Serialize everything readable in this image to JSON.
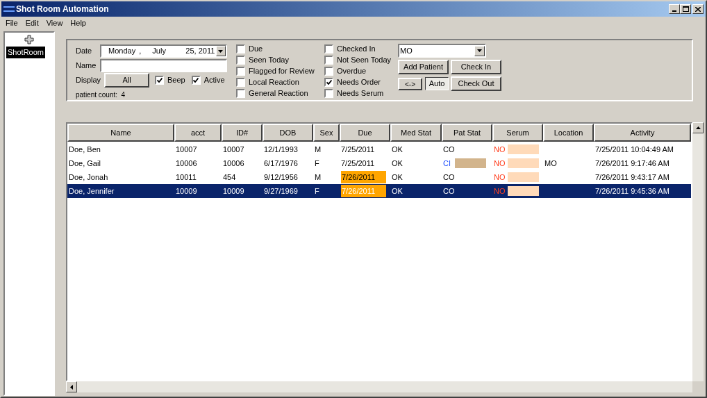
{
  "window": {
    "title": "Shot Room Automation"
  },
  "menu": [
    "File",
    "Edit",
    "View",
    "Help"
  ],
  "tree": {
    "items": [
      {
        "label": "ShotRoom",
        "selected": true
      }
    ]
  },
  "filters": {
    "date_label": "Date",
    "date": {
      "weekday": "Monday",
      "sep": ",",
      "month": "July",
      "day_year": "25, 2011"
    },
    "name_label": "Name",
    "display_label": "Display",
    "display_button": "All",
    "beep": {
      "label": "Beep",
      "checked": true
    },
    "active": {
      "label": "Active",
      "checked": true
    },
    "patient_count": "patient count:  4",
    "checkboxes": [
      [
        {
          "label": "Due",
          "checked": false
        },
        {
          "label": "Seen Today",
          "checked": false
        },
        {
          "label": "Flagged for Review",
          "checked": false
        },
        {
          "label": "Local Reaction",
          "checked": false
        },
        {
          "label": "General Reaction",
          "checked": false
        }
      ],
      [
        {
          "label": "Checked In",
          "checked": false
        },
        {
          "label": "Not Seen Today",
          "checked": false
        },
        {
          "label": "Overdue",
          "checked": false
        },
        {
          "label": "Needs Order",
          "checked": true
        },
        {
          "label": "Needs Serum",
          "checked": false
        }
      ]
    ],
    "location": "MO",
    "add_patient": "Add Patient",
    "check_in": "Check In",
    "swap": "<->",
    "auto": {
      "label": "Auto",
      "on": true
    },
    "check_out": "Check Out"
  },
  "table": {
    "columns": [
      "Name",
      "acct",
      "ID#",
      "DOB",
      "Sex",
      "Due",
      "Med Stat",
      "Pat Stat",
      "Serum",
      "Location",
      "Activity"
    ],
    "rows": [
      {
        "name": "Doe, Ben",
        "acct": "10007",
        "id": "10007",
        "dob": "12/1/1993",
        "sex": "M",
        "due": "7/25/2011",
        "due_highlight": false,
        "med_stat": "OK",
        "pat_stat": "CO",
        "pat_stat_highlight": false,
        "pat_stat_swatch": false,
        "serum": "NO",
        "activity": "7/25/2011 10:04:49 AM",
        "selected": false
      },
      {
        "name": "Doe, Gail",
        "acct": "10006",
        "id": "10006",
        "dob": "6/17/1976",
        "sex": "F",
        "due": "7/25/2011",
        "due_highlight": false,
        "med_stat": "OK",
        "pat_stat": "CI",
        "pat_stat_highlight": true,
        "pat_stat_swatch": true,
        "serum": "NO",
        "location": "MO",
        "activity": "7/26/2011 9:17:46 AM",
        "selected": false
      },
      {
        "name": "Doe, Jonah",
        "acct": "10011",
        "id": "454",
        "dob": "9/12/1956",
        "sex": "M",
        "due": "7/26/2011",
        "due_highlight": true,
        "med_stat": "OK",
        "pat_stat": "CO",
        "pat_stat_highlight": false,
        "pat_stat_swatch": false,
        "serum": "NO",
        "activity": "7/26/2011 9:43:17 AM",
        "selected": false
      },
      {
        "name": "Doe, Jennifer",
        "acct": "10009",
        "id": "10009",
        "dob": "9/27/1969",
        "sex": "F",
        "due": "7/26/2011",
        "due_highlight": true,
        "med_stat": "OK",
        "pat_stat": "CO",
        "pat_stat_highlight": false,
        "pat_stat_swatch": false,
        "serum": "NO",
        "activity": "7/26/2011 9:45:36 AM",
        "selected": true
      }
    ]
  }
}
